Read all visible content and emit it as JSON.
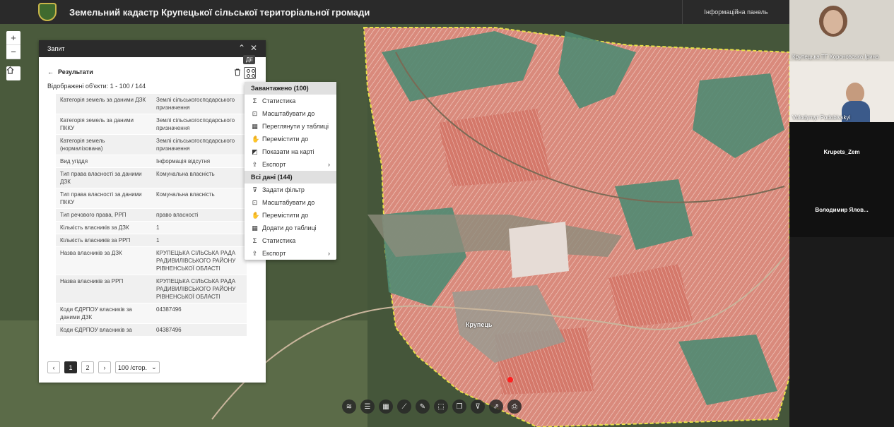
{
  "header": {
    "title": "Земельний кадастр Крупецької сільської територіальної громади",
    "info_panel": "Інформаційна панель"
  },
  "map": {
    "town_label": "Крупець",
    "zoom_in": "+",
    "zoom_out": "−"
  },
  "panel": {
    "title": "Запит",
    "results_label": "Результати",
    "shown": "Відображені об'єкти: 1 - 100 / 144",
    "actions_tooltip": "Дії",
    "rows": [
      {
        "k": "Категорія земель за даними ДЗК",
        "v": "Землі сільськогосподарського призначення"
      },
      {
        "k": "Категорія земель за даними ПККУ",
        "v": "Землі сільськогосподарського призначення"
      },
      {
        "k": "Категорія земель (нормалізована)",
        "v": "Землі сільськогосподарського призначення"
      },
      {
        "k": "Вид угіддя",
        "v": "Інформація відсутня"
      },
      {
        "k": "Тип права власності за даними ДЗК",
        "v": "Комунальна власність"
      },
      {
        "k": "Тип права власності за даними ПККУ",
        "v": "Комунальна власність"
      },
      {
        "k": "Тип речового права, РРП",
        "v": "право власності"
      },
      {
        "k": "Кількість власників за ДЗК",
        "v": "1"
      },
      {
        "k": "Кількість власників за РРП",
        "v": "1"
      },
      {
        "k": "Назва власників за ДЗК",
        "v": "КРУПЕЦЬКА СІЛЬСЬКА РАДА РАДИВИЛІВСЬКОГО РАЙОНУ РІВНЕНСЬКОЇ ОБЛАСТІ"
      },
      {
        "k": "Назва власників за РРП",
        "v": "КРУПЕЦЬКА СІЛЬСЬКА РАДА РАДИВИЛІВСЬКОГО РАЙОНУ РІВНЕНСЬКОЇ ОБЛАСТІ"
      },
      {
        "k": "Коди ЄДРПОУ власників за даними ДЗК",
        "v": "04387496"
      },
      {
        "k": "Коди ЄДРПОУ власників за",
        "v": "04387496"
      }
    ],
    "pager": {
      "prev": "‹",
      "page1": "1",
      "page2": "2",
      "next": "›",
      "page_size": "100 /стор."
    }
  },
  "menu": {
    "loaded_header": "Завантажено (100)",
    "loaded": [
      {
        "label": "Статистика",
        "icon": "Σ"
      },
      {
        "label": "Масштабувати до",
        "icon": "⊡"
      },
      {
        "label": "Переглянути у таблиці",
        "icon": "▦"
      },
      {
        "label": "Перемістити до",
        "icon": "✋"
      },
      {
        "label": "Показати на карті",
        "icon": "◩"
      },
      {
        "label": "Експорт",
        "icon": "⇪"
      }
    ],
    "all_header": "Всі дані (144)",
    "all": [
      {
        "label": "Задати фільтр",
        "icon": "⊽"
      },
      {
        "label": "Масштабувати до",
        "icon": "⊡"
      },
      {
        "label": "Перемістити до",
        "icon": "✋"
      },
      {
        "label": "Додати до таблиці",
        "icon": "▦"
      },
      {
        "label": "Статистика",
        "icon": "Σ"
      },
      {
        "label": "Експорт",
        "icon": "⇪"
      }
    ]
  },
  "video": {
    "p1": "Крупецька ТГ Хороновська Ірина",
    "p2": "Volodymyr Podobivskyi",
    "p3": "Krupets_Zem",
    "p4": "Володимир Ялов..."
  },
  "colors": {
    "parcel": "#d98a7c",
    "field_green": "#4f8a72",
    "boundary": "#e8e04a"
  }
}
